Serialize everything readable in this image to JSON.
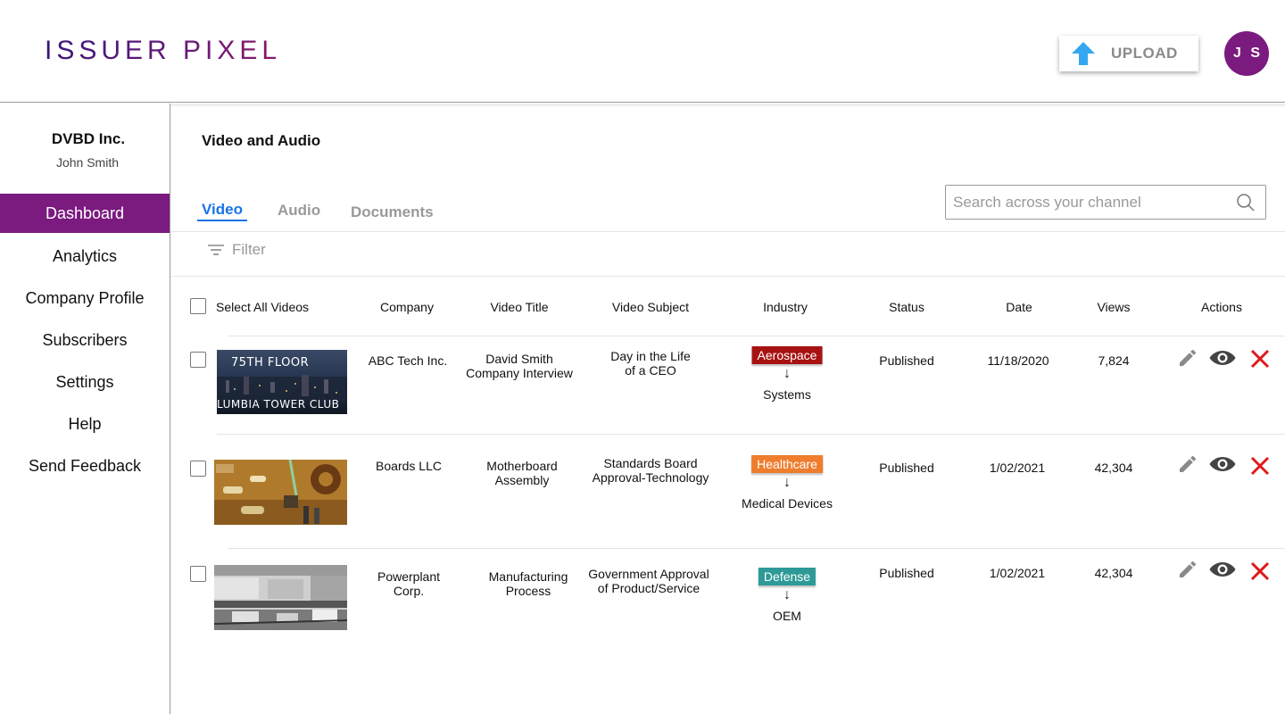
{
  "header": {
    "logo_text": "ISSUER PIXEL",
    "upload_label": "UPLOAD",
    "avatar_initials": "J S",
    "colors": {
      "brand": "#7b1a7f",
      "upload_arrow": "#33a8f0"
    }
  },
  "sidebar": {
    "org_name": "DVBD Inc.",
    "user_name": "John Smith",
    "items": [
      {
        "label": "Dashboard",
        "active": true
      },
      {
        "label": "Analytics"
      },
      {
        "label": "Company Profile"
      },
      {
        "label": "Subscribers"
      },
      {
        "label": "Settings"
      },
      {
        "label": "Help"
      },
      {
        "label": "Send Feedback"
      }
    ]
  },
  "main": {
    "title": "Video and Audio",
    "tabs": [
      {
        "label": "Video",
        "active": true
      },
      {
        "label": "Audio"
      },
      {
        "label": "Documents"
      }
    ],
    "search_placeholder": "Search across your channel",
    "filter_label": "Filter"
  },
  "table": {
    "select_all_label": "Select All Videos",
    "columns": [
      "Company",
      "Video Title",
      "Video Subject",
      "Industry",
      "Status",
      "Date",
      "Views",
      "Actions"
    ],
    "rows": [
      {
        "thumbnail": {
          "overlay_top": "75TH FLOOR",
          "overlay_bottom": "LUMBIA TOWER CLUB"
        },
        "company": [
          "ABC Tech Inc."
        ],
        "title": [
          "David Smith",
          "Company Interview"
        ],
        "subject": [
          "Day in the Life",
          "of a CEO"
        ],
        "industry": "Aerospace",
        "industry_color": "#a81212",
        "arrow": "↓",
        "sub_industry": "Systems",
        "status": "Published",
        "date": "11/18/2020",
        "views": "7,824"
      },
      {
        "thumbnail": {},
        "company": [
          "Boards LLC"
        ],
        "title": [
          "Motherboard",
          "Assembly"
        ],
        "subject": [
          "Standards Board",
          "Approval-Technology"
        ],
        "industry": "Healthcare",
        "industry_color": "#ef7d2e",
        "arrow": "↓",
        "sub_industry": "Medical Devices",
        "status": "Published",
        "date": "1/02/2021",
        "views": "42,304"
      },
      {
        "thumbnail": {},
        "company": [
          "Powerplant",
          "Corp."
        ],
        "title": [
          "Manufacturing",
          "Process"
        ],
        "subject": [
          "Government Approval",
          "of Product/Service"
        ],
        "industry": "Defense",
        "industry_color": "#2e9a97",
        "arrow": "↓",
        "sub_industry": "OEM",
        "status": "Published",
        "date": "1/02/2021",
        "views": "42,304"
      }
    ],
    "action_icons": [
      "pencil-icon",
      "eye-icon",
      "close-icon"
    ],
    "action_colors": {
      "edit": "#8a8a8a",
      "view": "#444444",
      "delete": "#e0191b"
    }
  }
}
